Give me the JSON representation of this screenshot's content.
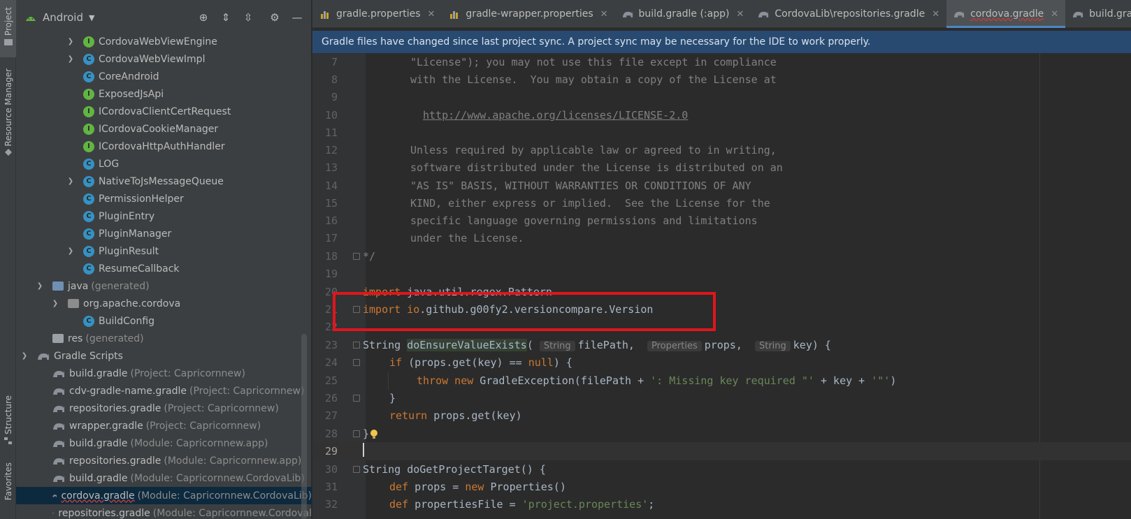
{
  "toolstrip": {
    "project_label": "Project",
    "resource_manager_label": "Resource Manager",
    "structure_label": "Structure",
    "favorites_label": "Favorites"
  },
  "project_panel": {
    "view_name": "Android",
    "tree": [
      {
        "name": "CordovaWebViewEngine",
        "kind": "i",
        "expandable": true
      },
      {
        "name": "CordovaWebViewImpl",
        "kind": "c",
        "expandable": true
      },
      {
        "name": "CoreAndroid",
        "kind": "c",
        "expandable": false
      },
      {
        "name": "ExposedJsApi",
        "kind": "i",
        "expandable": false
      },
      {
        "name": "ICordovaClientCertRequest",
        "kind": "i",
        "expandable": false
      },
      {
        "name": "ICordovaCookieManager",
        "kind": "i",
        "expandable": false
      },
      {
        "name": "ICordovaHttpAuthHandler",
        "kind": "i",
        "expandable": false
      },
      {
        "name": "LOG",
        "kind": "c",
        "expandable": false
      },
      {
        "name": "NativeToJsMessageQueue",
        "kind": "c",
        "expandable": true
      },
      {
        "name": "PermissionHelper",
        "kind": "c",
        "expandable": false
      },
      {
        "name": "PluginEntry",
        "kind": "c",
        "expandable": false
      },
      {
        "name": "PluginManager",
        "kind": "c",
        "expandable": false
      },
      {
        "name": "PluginResult",
        "kind": "c",
        "expandable": true
      },
      {
        "name": "ResumeCallback",
        "kind": "c",
        "expandable": false
      }
    ],
    "java_generated": {
      "name": "java",
      "hint": "(generated)"
    },
    "package_name": "org.apache.cordova",
    "build_config": "BuildConfig",
    "res_generated": {
      "name": "res",
      "hint": "(generated)"
    },
    "gradle_scripts": "Gradle Scripts",
    "gradle_files": [
      {
        "name": "build.gradle",
        "hint": "(Project: Capricornnew)"
      },
      {
        "name": "cdv-gradle-name.gradle",
        "hint": "(Project: Capricornnew)"
      },
      {
        "name": "repositories.gradle",
        "hint": "(Project: Capricornnew)"
      },
      {
        "name": "wrapper.gradle",
        "hint": "(Project: Capricornnew)"
      },
      {
        "name": "build.gradle",
        "hint": "(Module: Capricornnew.app)"
      },
      {
        "name": "repositories.gradle",
        "hint": "(Module: Capricornnew.app)"
      },
      {
        "name": "build.gradle",
        "hint": "(Module: Capricornnew.CordovaLib)"
      },
      {
        "name": "cordova.gradle",
        "hint": "(Module: Capricornnew.CordovaLib)"
      },
      {
        "name": "repositories.gradle",
        "hint": "(Module: Capricornnew.Cordoval"
      }
    ]
  },
  "tabs": [
    {
      "label": "gradle.properties"
    },
    {
      "label": "gradle-wrapper.properties"
    },
    {
      "label": "build.gradle (:app)"
    },
    {
      "label": "CordovaLib\\repositories.gradle"
    },
    {
      "label": "cordova.gradle"
    },
    {
      "label": "build.gradle (Ca"
    }
  ],
  "banner": "Gradle files have changed since last project sync. A project sync may be necessary for the IDE to work properly.",
  "editor": {
    "lines": {
      "l7": {
        "n": "7",
        "text": "\"License\"); you may not use this file except in compliance"
      },
      "l8": {
        "n": "8",
        "text": "with the License.  You may obtain a copy of the License at"
      },
      "l9": {
        "n": "9"
      },
      "l10": {
        "n": "10",
        "text": "http://www.apache.org/licenses/LICENSE-2.0"
      },
      "l11": {
        "n": "11"
      },
      "l12": {
        "n": "12",
        "text": "Unless required by applicable law or agreed to in writing,"
      },
      "l13": {
        "n": "13",
        "text": "software distributed under the License is distributed on an"
      },
      "l14": {
        "n": "14",
        "text": "\"AS IS\" BASIS, WITHOUT WARRANTIES OR CONDITIONS OF ANY"
      },
      "l15": {
        "n": "15",
        "text": "KIND, either express or implied.  See the License for the"
      },
      "l16": {
        "n": "16",
        "text": "specific language governing permissions and limitations"
      },
      "l17": {
        "n": "17",
        "text": "under the License."
      },
      "l18": {
        "n": "18",
        "text": "*/"
      },
      "l19": {
        "n": "19"
      },
      "l20": {
        "n": "20",
        "kw": "import",
        "text": " java.util.regex.Pattern"
      },
      "l21": {
        "n": "21",
        "kw": "import",
        "pkg": "io",
        "text": ".github.g00fy2.versioncompare.Version"
      },
      "l22": {
        "n": "22"
      },
      "l23": {
        "n": "23",
        "t1": "String ",
        "fn": "doEnsureValueExists",
        "t2": "(",
        "h1": "String",
        "t3": "filePath, ",
        "h2": "Properties",
        "t4": "props, ",
        "h3": "String",
        "t5": "key) {"
      },
      "l24": {
        "n": "24",
        "kw": "if",
        "t1": " (props.get(key) == ",
        "kw2": "null",
        "t2": ") {"
      },
      "l25": {
        "n": "25",
        "kw": "throw new",
        "t1": " GradleException(filePath + ",
        "s1": "': Missing key required \"'",
        "t2": " + key + ",
        "s2": "'\"'",
        "t3": ")"
      },
      "l26": {
        "n": "26",
        "text": "}"
      },
      "l27": {
        "n": "27",
        "kw": "return",
        "text": " props.get(key)"
      },
      "l28": {
        "n": "28",
        "text": "}"
      },
      "l29": {
        "n": "29"
      },
      "l30": {
        "n": "30",
        "text": "String doGetProjectTarget() {"
      },
      "l31": {
        "n": "31",
        "kw": "def",
        "t1": " props = ",
        "kw2": "new",
        "t2": " Properties()"
      },
      "l32": {
        "n": "32",
        "kw": "def",
        "t1": " propertiesFile = ",
        "s1": "'project.properties'",
        "t2": ";"
      }
    }
  },
  "colors": {
    "accent": "#4a88c7",
    "banner_bg": "#294a70",
    "highlight_box": "#e0151c",
    "keyword": "#cc7832",
    "string": "#6a8759",
    "comment": "#808080"
  }
}
